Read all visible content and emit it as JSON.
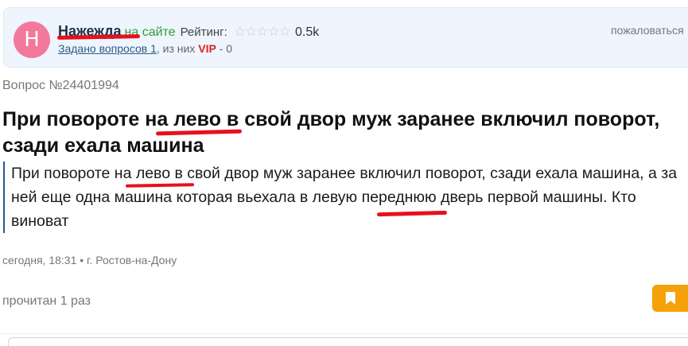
{
  "user": {
    "avatar_letter": "Н",
    "name": "Нажежда",
    "status": "на сайте",
    "rating_label": "Рейтинг:",
    "stars": "☆☆☆☆☆",
    "rating_value": "0.5k",
    "asked_link": "Задано вопросов 1",
    "asked_suffix": ", из них",
    "vip_label": "VIP",
    "vip_count": "- 0",
    "complain": "пожаловаться"
  },
  "question": {
    "number": "Вопрос №24401994",
    "title_before": "При повороте ",
    "title_mark": "на лево",
    "title_after": " в свой двор муж заранее включил поворот, сзади ехала машина",
    "body_before": "При повороте ",
    "body_mark1": "на лево",
    "body_middle": " в свой двор муж заранее включил поворот, сзади ехала машина, а за ней еще одна машина которая ",
    "body_mark2": "вьехала",
    "body_after": " в левую переднюю дверь первой машины. Кто виноват",
    "meta": "сегодня, 18:31 • г. Ростов-на-Дону",
    "read_count": "прочитан 1 раз"
  },
  "colors": {
    "accent": "#2a5b8c",
    "online": "#2c9e3a",
    "vip": "#d8232a",
    "bookmark": "#f5a10a",
    "annotation": "#e8101c",
    "avatar": "#f2799b"
  },
  "icons": {
    "bookmark": "bookmark-icon",
    "star": "star-icon"
  }
}
